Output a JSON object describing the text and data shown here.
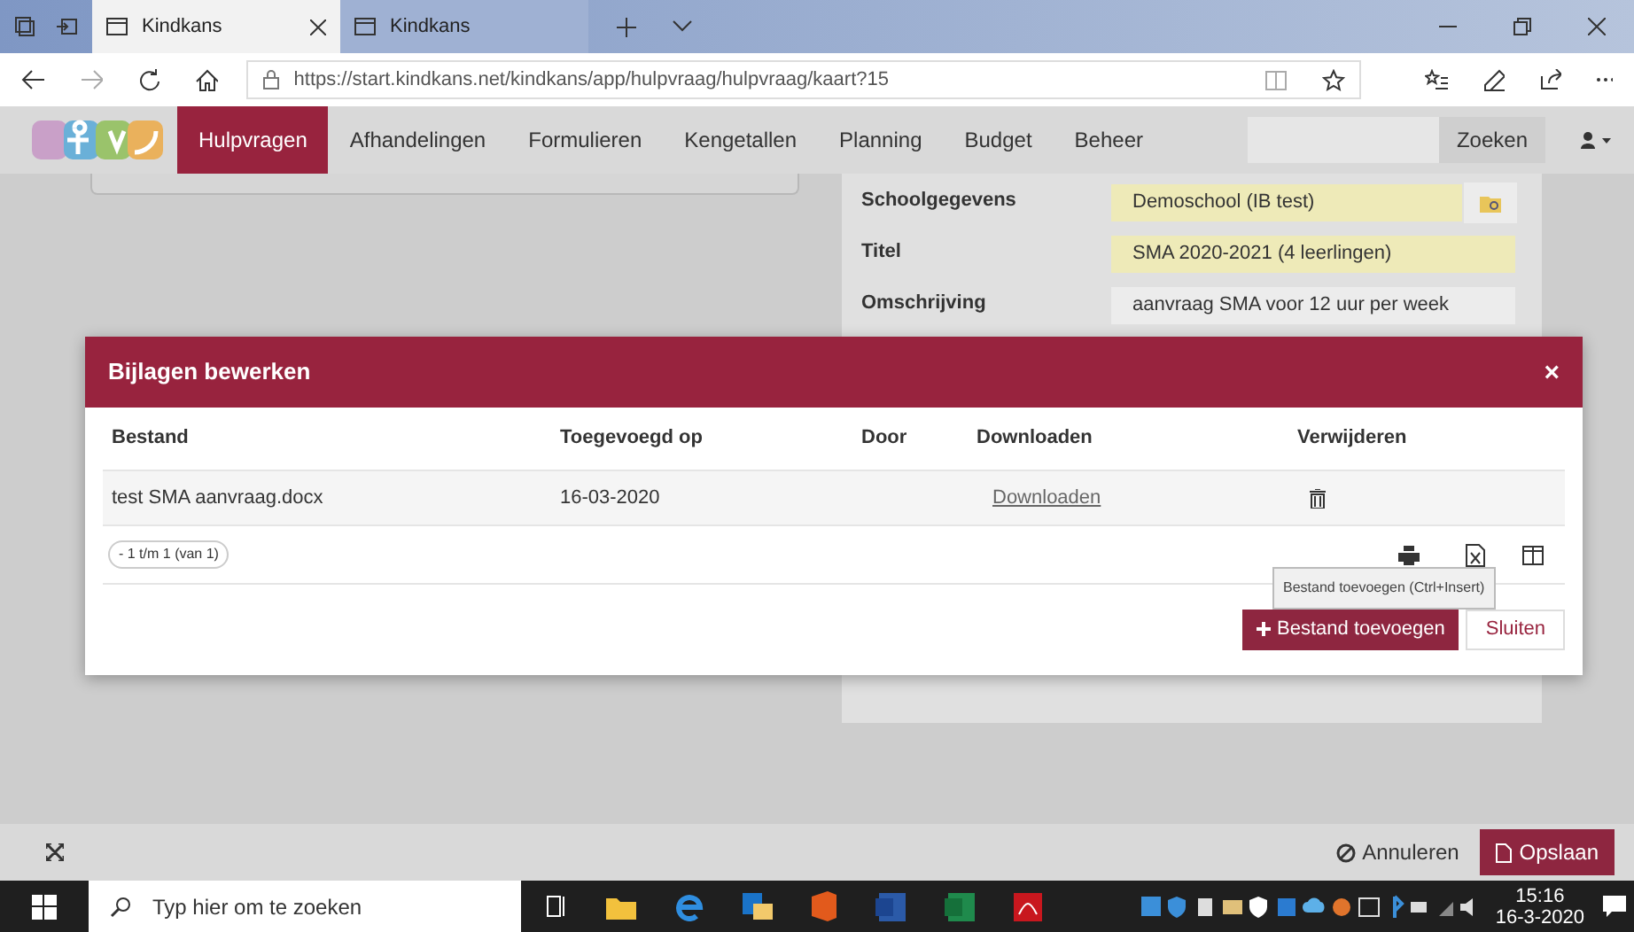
{
  "browser": {
    "tabs": [
      {
        "title": "Kindkans",
        "selected": true
      },
      {
        "title": "Kindkans",
        "selected": false
      }
    ],
    "url": "https://start.kindkans.net/kindkans/app/hulpvraag/hulpvraag/kaart?15"
  },
  "nav": {
    "items": [
      {
        "label": "Hulpvragen",
        "selected": true
      },
      {
        "label": "Afhandelingen",
        "selected": false
      },
      {
        "label": "Formulieren",
        "selected": false
      },
      {
        "label": "Kengetallen",
        "selected": false
      },
      {
        "label": "Planning",
        "selected": false
      },
      {
        "label": "Budget",
        "selected": false
      },
      {
        "label": "Beheer",
        "selected": false
      }
    ],
    "search_button": "Zoeken"
  },
  "form": {
    "fields": [
      {
        "label": "Schoolgegevens",
        "value": "Demoschool (IB test)",
        "kind": "lookup"
      },
      {
        "label": "Titel",
        "value": "SMA 2020-2021 (4 leerlingen)",
        "kind": "text"
      },
      {
        "label": "Omschrijving",
        "value": "aanvraag SMA voor 12 uur per week",
        "kind": "plain"
      }
    ]
  },
  "modal": {
    "title": "Bijlagen bewerken",
    "close": "×",
    "columns": [
      "Bestand",
      "Toegevoegd op",
      "Door",
      "Downloaden",
      "Verwijderen"
    ],
    "rows": [
      {
        "file": "test SMA aanvraag.docx",
        "date": "16-03-2020",
        "download": "Downloaden"
      }
    ],
    "pager": "- 1 t/m 1 (van 1)",
    "tooltip": "Bestand toevoegen (Ctrl+Insert)",
    "add_button": "Bestand toevoegen",
    "close_button": "Sluiten"
  },
  "footer": {
    "cancel": "Annuleren",
    "save": "Opslaan"
  },
  "taskbar": {
    "search_placeholder": "Typ hier om te zoeken",
    "time": "15:16",
    "date": "16-3-2020"
  }
}
